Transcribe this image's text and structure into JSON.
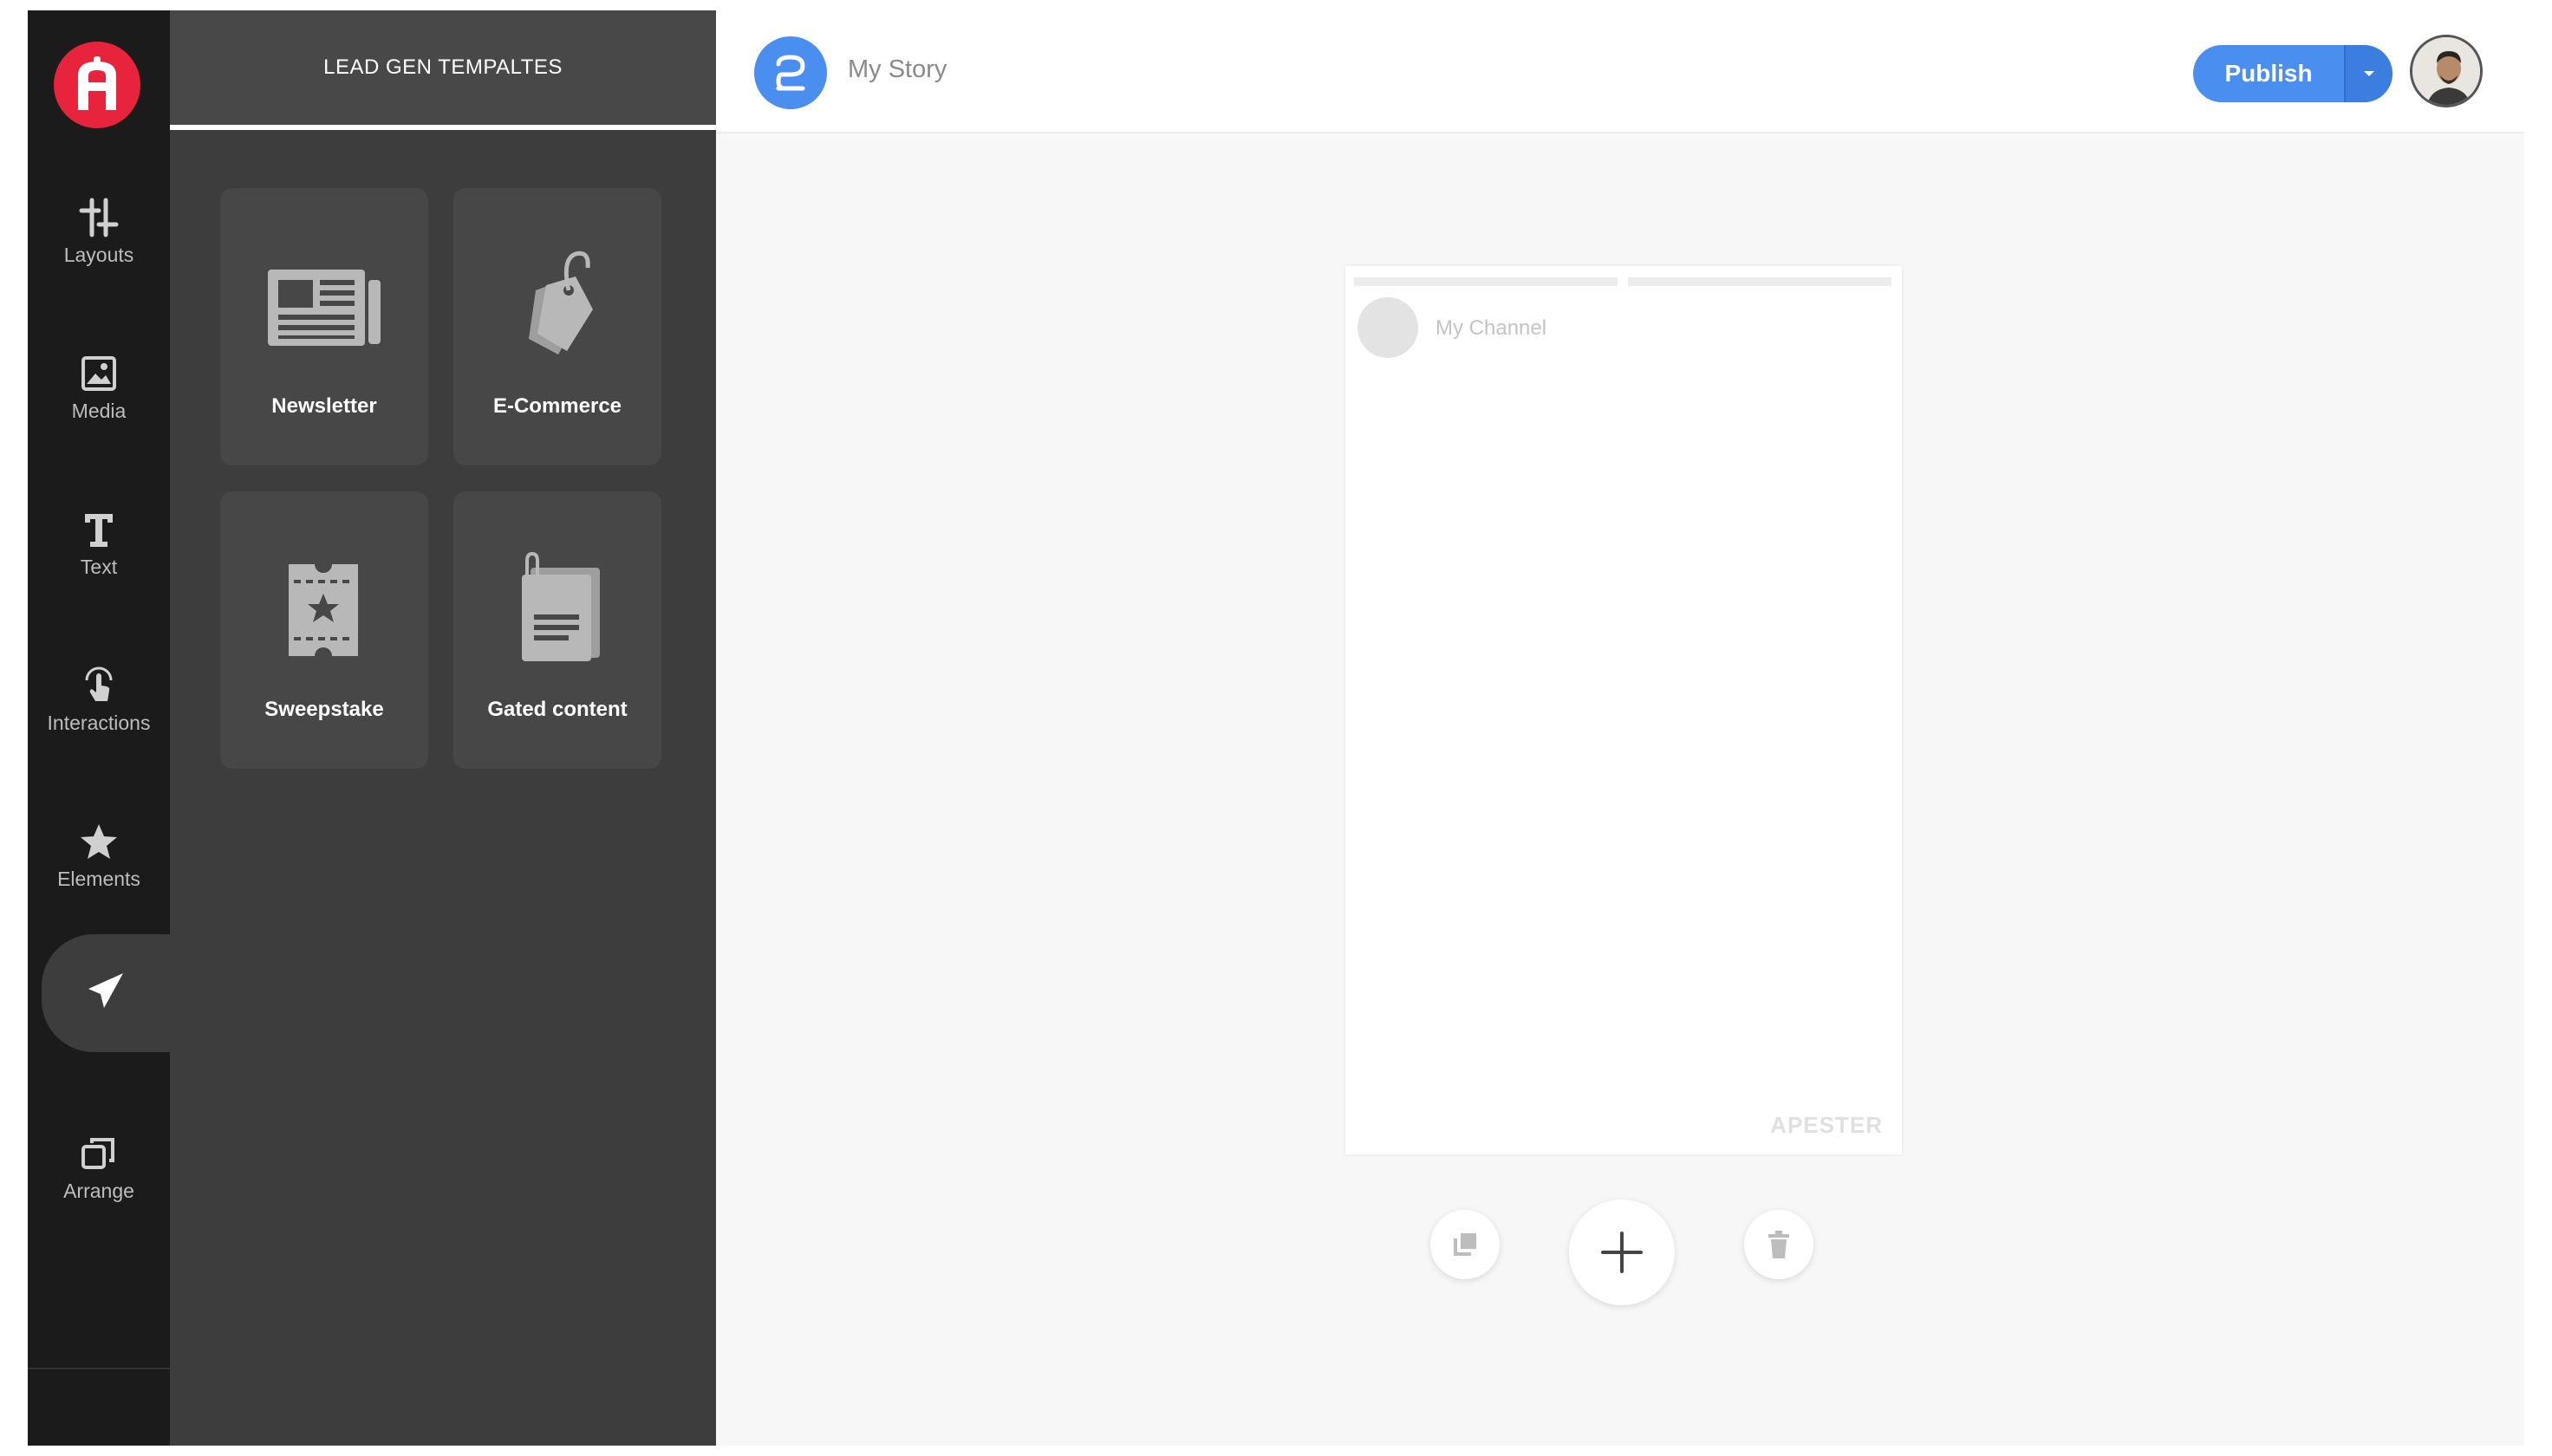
{
  "rail": {
    "items": [
      {
        "label": "Layouts",
        "icon": "layouts-icon"
      },
      {
        "label": "Media",
        "icon": "media-icon"
      },
      {
        "label": "Text",
        "icon": "text-icon"
      },
      {
        "label": "Interactions",
        "icon": "interactions-icon"
      },
      {
        "label": "Elements",
        "icon": "star-icon"
      },
      {
        "label": "",
        "icon": "paper-plane-icon"
      },
      {
        "label": "Arrange",
        "icon": "arrange-icon"
      }
    ],
    "active_index": 5
  },
  "panel": {
    "title": "LEAD GEN TEMPALTES",
    "templates": [
      {
        "label": "Newsletter",
        "icon": "newspaper-icon"
      },
      {
        "label": "E-Commerce",
        "icon": "price-tag-icon"
      },
      {
        "label": "Sweepstake",
        "icon": "ticket-icon"
      },
      {
        "label": "Gated content",
        "icon": "document-icon"
      }
    ]
  },
  "header": {
    "story_title": "My Story",
    "publish_label": "Publish"
  },
  "story": {
    "channel_name": "My Channel",
    "watermark": "APESTER"
  },
  "colors": {
    "brand_red": "#e8243c",
    "accent_blue": "#4a8ff0",
    "rail_bg": "#1b1b1b",
    "panel_bg": "#3d3d3d"
  }
}
